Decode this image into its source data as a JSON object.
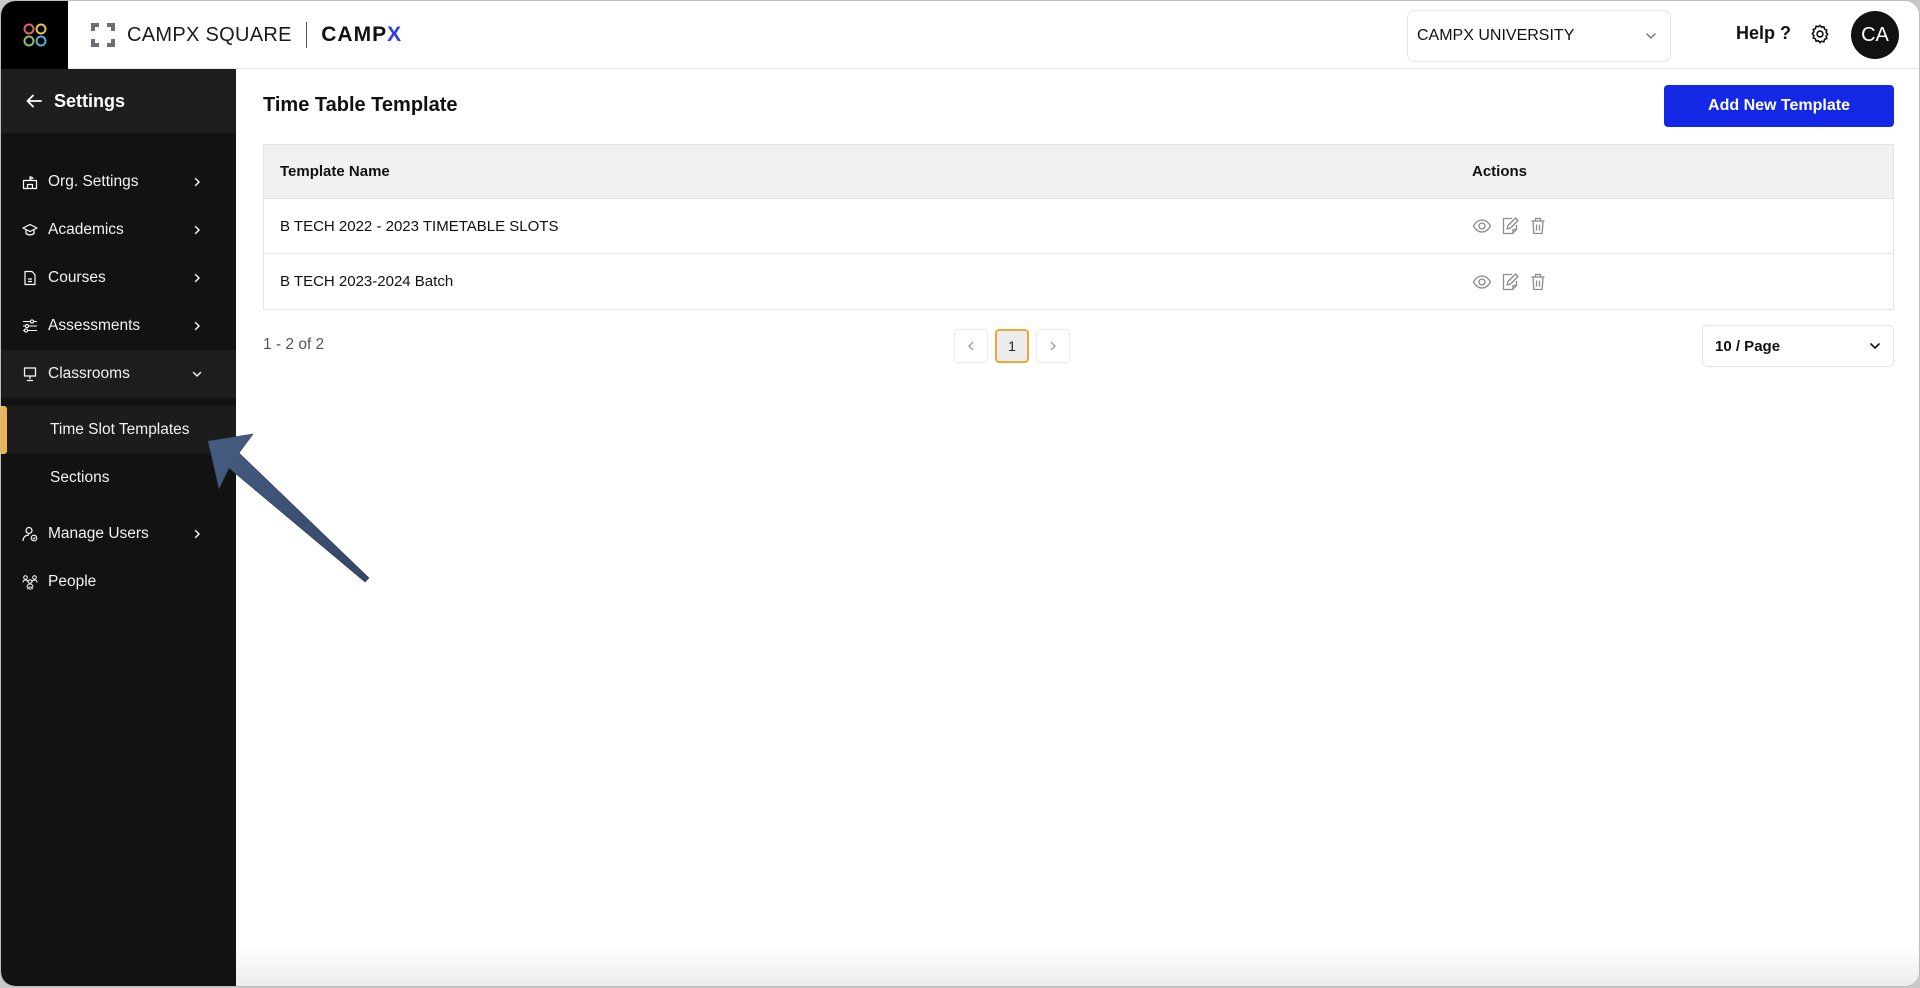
{
  "header": {
    "brand_name": "CAMPX SQUARE",
    "brand_secondary": "CAMP",
    "brand_secondary_x": "X",
    "org_selector": {
      "value": "CAMPX UNIVERSITY"
    },
    "help_label": "Help ?",
    "avatar_initials": "CA"
  },
  "sidebar": {
    "title": "Settings",
    "items": [
      {
        "label": "Org. Settings",
        "icon": "building-icon",
        "expandable": true,
        "expanded": false
      },
      {
        "label": "Academics",
        "icon": "graduation-cap-icon",
        "expandable": true,
        "expanded": false
      },
      {
        "label": "Courses",
        "icon": "document-icon",
        "expandable": true,
        "expanded": false
      },
      {
        "label": "Assessments",
        "icon": "sliders-icon",
        "expandable": true,
        "expanded": false
      },
      {
        "label": "Classrooms",
        "icon": "presentation-board-icon",
        "expandable": true,
        "expanded": true,
        "children": [
          {
            "label": "Time Slot Templates",
            "active": true
          },
          {
            "label": "Sections",
            "active": false
          }
        ]
      },
      {
        "label": "Manage Users",
        "icon": "user-check-icon",
        "expandable": true,
        "expanded": false
      },
      {
        "label": "People",
        "icon": "people-group-icon",
        "expandable": false
      }
    ]
  },
  "main": {
    "title": "Time Table Template",
    "add_button_label": "Add New Template",
    "table": {
      "columns": [
        "Template Name",
        "Actions"
      ],
      "rows": [
        {
          "name": "B TECH 2022 - 2023 TIMETABLE SLOTS",
          "actions": [
            "view-icon",
            "edit-icon",
            "delete-icon"
          ]
        },
        {
          "name": "B TECH 2023-2024 Batch",
          "actions": [
            "view-icon",
            "edit-icon",
            "delete-icon"
          ]
        }
      ]
    },
    "pagination": {
      "range_text": "1 - 2 of 2",
      "current_page": "1",
      "page_size": "10 / Page"
    }
  },
  "colors": {
    "accent_primary": "#1428e6",
    "active_indicator": "#f0b24a",
    "sidebar_bg": "#121212",
    "annotation_arrow": "#3e5478"
  }
}
